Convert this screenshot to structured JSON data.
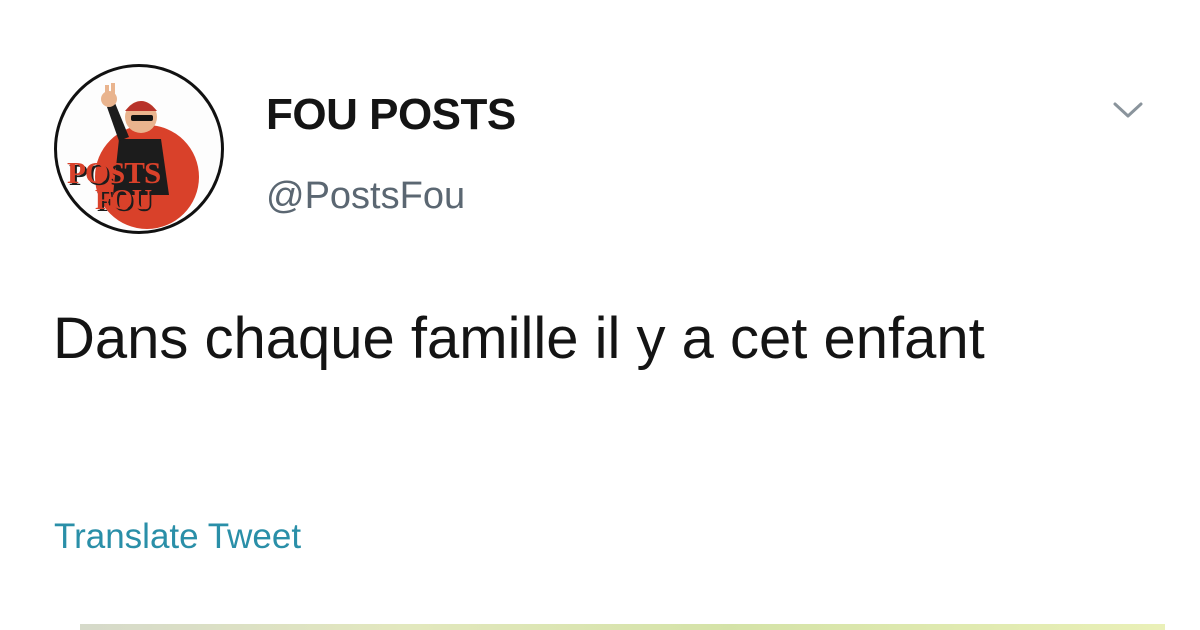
{
  "account": {
    "display_name": "FOU POSTS",
    "handle": "@PostsFou",
    "avatar_text_line1": "POSTS",
    "avatar_text_line2": "FOU"
  },
  "tweet": {
    "text": "Dans chaque famille il y a cet enfant",
    "translate_label": "Translate Tweet"
  },
  "icons": {
    "menu": "chevron-down-icon",
    "avatar": "avatar"
  },
  "colors": {
    "name_text": "#141414",
    "handle_text": "#5b6772",
    "link": "#2a8fa8",
    "avatar_red": "#d9412a",
    "background": "#ffffff"
  }
}
